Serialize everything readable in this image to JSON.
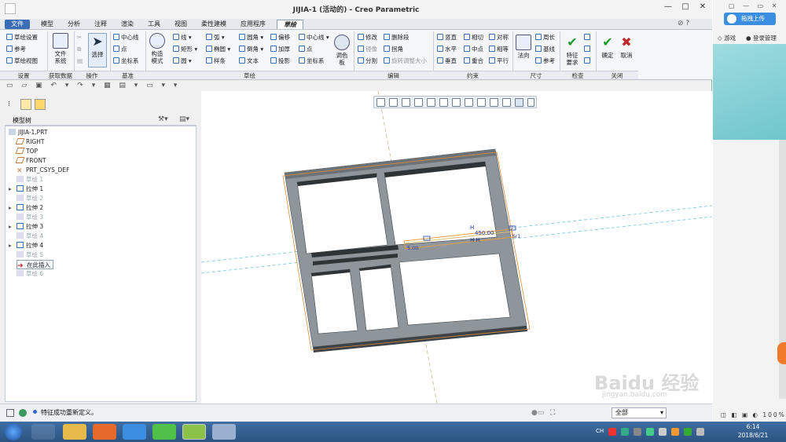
{
  "window": {
    "title": "JIJIA-1 (活动的) - Creo Parametric",
    "min": "—",
    "max": "□",
    "close": "✕"
  },
  "tabs": [
    "文件",
    "模型",
    "分析",
    "注释",
    "渲染",
    "工具",
    "视图",
    "柔性建模",
    "应用程序",
    "草绘"
  ],
  "ribbon": {
    "setup": [
      "草绘设置",
      "参考",
      "草绘视图"
    ],
    "file_system": "文件\n系统",
    "select": "选择",
    "datum": [
      "中心线",
      "点",
      "坐标系"
    ],
    "construct": "构造\n模式",
    "sketch": [
      "线",
      "弧",
      "圆角",
      "偏移",
      "中心线",
      "矩形",
      "椭圆",
      "倒角",
      "加厚",
      "点",
      "圆",
      "样条",
      "文本",
      "投影",
      "坐标系"
    ],
    "palette": "调色\n板",
    "edit": [
      "修改",
      "删除段",
      "镜像",
      "拐角",
      "分割",
      "旋转调整大小"
    ],
    "constrain": [
      "竖直",
      "相切",
      "对称",
      "水平",
      "中点",
      "相等",
      "垂直",
      "重合",
      "平行"
    ],
    "dimension": [
      "法向",
      "周长",
      "基线",
      "参考"
    ],
    "inspect": "特征\n要求",
    "ok": "确定",
    "cancel": "取消",
    "groups": [
      "设置",
      "获取数据",
      "操作",
      "基准",
      "草绘",
      "编辑",
      "约束",
      "尺寸",
      "检查",
      "关闭"
    ]
  },
  "tree": {
    "title": "模型树",
    "items": [
      {
        "label": "JIJIA-1.PRT",
        "dim": false
      },
      {
        "label": "RIGHT",
        "dim": false
      },
      {
        "label": "TOP",
        "dim": false
      },
      {
        "label": "FRONT",
        "dim": false
      },
      {
        "label": "PRT_CSYS_DEF",
        "dim": false
      },
      {
        "label": "草绘 1",
        "dim": true
      },
      {
        "label": "拉伸 1",
        "dim": false
      },
      {
        "label": "草绘 2",
        "dim": true
      },
      {
        "label": "拉伸 2",
        "dim": false
      },
      {
        "label": "草绘 3",
        "dim": true
      },
      {
        "label": "拉伸 3",
        "dim": false
      },
      {
        "label": "草绘 4",
        "dim": true
      },
      {
        "label": "拉伸 4",
        "dim": false
      },
      {
        "label": "草绘 5",
        "dim": true
      },
      {
        "label": "在此插入",
        "dim": false
      },
      {
        "label": "草绘 6",
        "dim": true
      }
    ]
  },
  "canvas": {
    "dimension_text": "450.00",
    "small_dim": "5.00",
    "csys_label": "PRT_CSYS_DEF",
    "h1": "H",
    "h2": "H H",
    "t1": "T",
    "sr": "Sr1"
  },
  "status": {
    "message": "特征成功重新定义。",
    "filter": "全部"
  },
  "side": {
    "upload": "拖拽上传",
    "games": "游戏",
    "login": "登录管理"
  },
  "taskbar": {
    "lang": "CH",
    "time": "6:14",
    "date": "2018/6/21"
  },
  "watermark": {
    "main": "Baidu 经验",
    "sub": "jingyan.baidu.com"
  },
  "colors": {
    "accent": "#3a6db5",
    "frame": "#8e969c",
    "ok": "#1a9a2a",
    "cancel": "#c0282c"
  }
}
